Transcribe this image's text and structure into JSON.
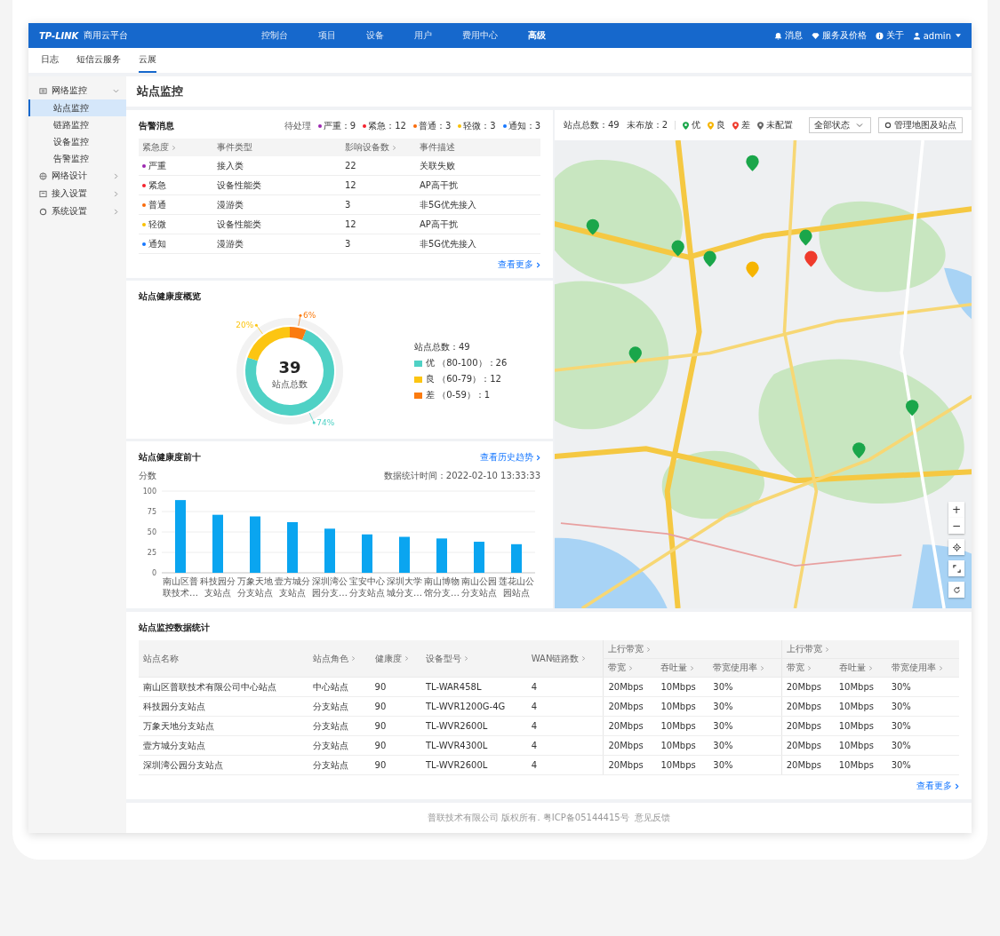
{
  "topbar": {
    "logo": "TP-LINK",
    "product": "商用云平台",
    "nav": [
      {
        "label": "控制台",
        "selected": false
      },
      {
        "label": "项目",
        "selected": false
      },
      {
        "label": "设备",
        "selected": false
      },
      {
        "label": "用户",
        "selected": false
      },
      {
        "label": "费用中心",
        "selected": false
      },
      {
        "label": "高级",
        "selected": true
      }
    ],
    "links": [
      {
        "kind": "bell",
        "label": "消息"
      },
      {
        "kind": "diamond",
        "label": "服务及价格"
      },
      {
        "kind": "info",
        "label": "关于"
      },
      {
        "kind": "user",
        "label": "admin"
      }
    ]
  },
  "tabs": [
    {
      "label": "日志",
      "selected": false
    },
    {
      "label": "短信云服务",
      "selected": false
    },
    {
      "label": "云展",
      "selected": true
    }
  ],
  "sidebar": {
    "items": [
      {
        "label": "网络监控",
        "expanded": true,
        "children": [
          {
            "label": "站点监控",
            "selected": true
          },
          {
            "label": "链路监控",
            "selected": false
          },
          {
            "label": "设备监控",
            "selected": false
          },
          {
            "label": "告警监控",
            "selected": false
          }
        ]
      },
      {
        "label": "网络设计",
        "expanded": false
      },
      {
        "label": "接入设置",
        "expanded": false
      },
      {
        "label": "系统设置",
        "expanded": false
      }
    ]
  },
  "page_title": "站点监控",
  "alarms": {
    "title": "告警消息",
    "pending_label": "待处理",
    "counts": [
      {
        "label": "严重：9",
        "color": "#9c27b0"
      },
      {
        "label": "紧急：12",
        "color": "#f5222d"
      },
      {
        "label": "普通：3",
        "color": "#fa6a0a"
      },
      {
        "label": "轻微：3",
        "color": "#fac000"
      },
      {
        "label": "通知：3",
        "color": "#1677ff"
      }
    ],
    "columns": [
      {
        "label": "紧急度",
        "sortable": true
      },
      {
        "label": "事件类型",
        "sortable": false
      },
      {
        "label": "影响设备数",
        "sortable": true
      },
      {
        "label": "事件描述",
        "sortable": false
      }
    ],
    "rows": [
      {
        "level": "严重",
        "color": "#9c27b0",
        "type": "接入类",
        "count": "22",
        "desc": "关联失败"
      },
      {
        "level": "紧急",
        "color": "#f5222d",
        "type": "设备性能类",
        "count": "12",
        "desc": "AP高干扰"
      },
      {
        "level": "普通",
        "color": "#fa6a0a",
        "type": "漫游类",
        "count": "3",
        "desc": "非5G优先接入"
      },
      {
        "level": "轻微",
        "color": "#fac000",
        "type": "设备性能类",
        "count": "12",
        "desc": "AP高干扰"
      },
      {
        "level": "通知",
        "color": "#1677ff",
        "type": "漫游类",
        "count": "3",
        "desc": "非5G优先接入"
      }
    ],
    "more": "查看更多"
  },
  "health": {
    "title": "站点健康度概览",
    "center_value": "39",
    "center_label": "站点总数",
    "total": "站点总数：49",
    "legend": [
      {
        "range": "（80-100）：26",
        "color": "#4fd1c5"
      },
      {
        "range": "（60-79）：12",
        "color": "#fcc512"
      },
      {
        "range": "（0-59）：1",
        "color": "#fb7b0f"
      }
    ],
    "chart_data": {
      "type": "donut",
      "categories": [
        "优",
        "良",
        "差"
      ],
      "values": [
        74,
        20,
        6
      ],
      "data_labels": true,
      "value_labels": [
        "74%",
        "20%",
        "6%"
      ]
    }
  },
  "top_ten": {
    "title": "站点健康度前十",
    "link": "查看历史趋势",
    "time": "数据统计时间：2022-02-10 13:33:33",
    "chart_data": {
      "type": "bar",
      "ylabel": "分数",
      "categories": [
        "南山区普联技术…",
        "科技园分支站点",
        "万象天地分支站点",
        "壹方城分支站点",
        "深圳湾公园分支…",
        "宝安中心分支站点",
        "深圳大学城分支…",
        "南山博物馆分支…",
        "南山公园分支站点",
        "莲花山公园站点"
      ],
      "series": [
        {
          "color": "#0aa5f0",
          "values": [
            89,
            71,
            69,
            62,
            54,
            47,
            44,
            42,
            38,
            35
          ]
        }
      ],
      "ylim": [
        0,
        100
      ],
      "yticks": [
        0,
        25,
        50,
        75,
        100
      ],
      "grid": true
    }
  },
  "map": {
    "total": "站点总数：49",
    "unplaced": "未布放：2",
    "legend": [
      {
        "label": "优",
        "color": "#1aa64a"
      },
      {
        "label": "良",
        "color": "#f6b400"
      },
      {
        "label": "差",
        "color": "#ef3b2c"
      },
      {
        "label": "未配置",
        "color": "#666666"
      }
    ],
    "status_select": "全部状态",
    "manage_button": "管理地图及站点",
    "zoom_in": "+",
    "zoom_out": "−"
  },
  "stats": {
    "title": "站点监控数据统计",
    "columns": [
      {
        "label": "站点名称",
        "sortable": false
      },
      {
        "label": "站点角色",
        "sortable": true
      },
      {
        "label": "健康度",
        "sortable": true
      },
      {
        "label": "设备型号",
        "sortable": true
      },
      {
        "label": "WAN链路数",
        "sortable": true
      }
    ],
    "groups": [
      {
        "label": "上行带宽",
        "sortable": true,
        "columns": [
          {
            "label": "带宽",
            "sortable": true
          },
          {
            "label": "吞吐量",
            "sortable": true
          },
          {
            "label": "带宽使用率",
            "sortable": true
          }
        ]
      },
      {
        "label": "上行带宽",
        "sortable": true,
        "columns": [
          {
            "label": "带宽",
            "sortable": true
          },
          {
            "label": "吞吐量",
            "sortable": true
          },
          {
            "label": "带宽使用率",
            "sortable": true
          }
        ]
      }
    ],
    "rows": [
      [
        "南山区普联技术有限公司中心站点",
        "中心站点",
        "90",
        "TL-WAR458L",
        "4",
        "20Mbps",
        "10Mbps",
        "30%",
        "20Mbps",
        "10Mbps",
        "30%"
      ],
      [
        "科技园分支站点",
        "分支站点",
        "90",
        "TL-WVR1200G-4G",
        "4",
        "20Mbps",
        "10Mbps",
        "30%",
        "20Mbps",
        "10Mbps",
        "30%"
      ],
      [
        "万象天地分支站点",
        "分支站点",
        "90",
        "TL-WVR2600L",
        "4",
        "20Mbps",
        "10Mbps",
        "30%",
        "20Mbps",
        "10Mbps",
        "30%"
      ],
      [
        "壹方城分支站点",
        "分支站点",
        "90",
        "TL-WVR4300L",
        "4",
        "20Mbps",
        "10Mbps",
        "30%",
        "20Mbps",
        "10Mbps",
        "30%"
      ],
      [
        "深圳湾公园分支站点",
        "分支站点",
        "90",
        "TL-WVR2600L",
        "4",
        "20Mbps",
        "10Mbps",
        "30%",
        "20Mbps",
        "10Mbps",
        "30%"
      ]
    ],
    "more": "查看更多"
  },
  "footer": {
    "text": "普联技术有限公司 版权所有. 粤ICP备05144415号",
    "link": "意见反馈"
  }
}
